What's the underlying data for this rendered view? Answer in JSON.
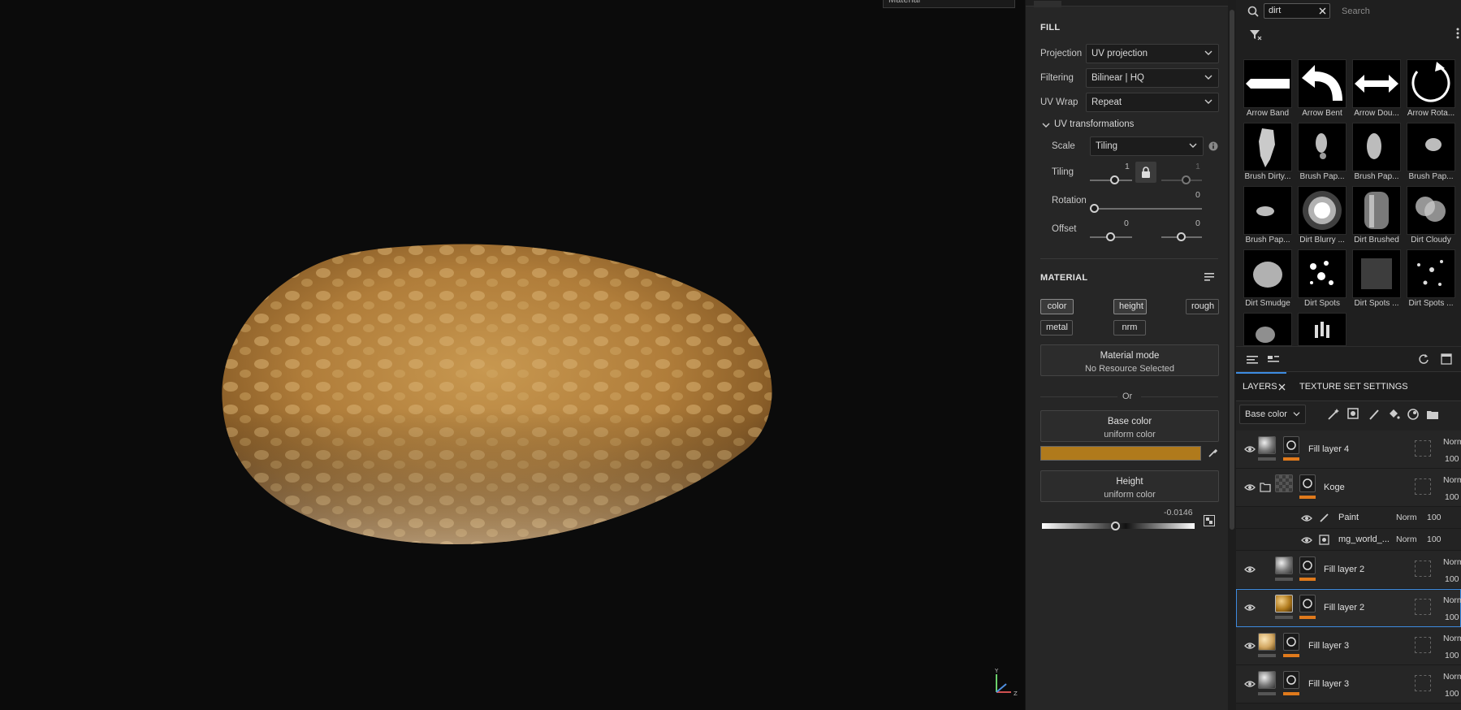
{
  "viewport": {
    "top_dropdown": "Material"
  },
  "properties": {
    "fill_title": "FILL",
    "projection": {
      "label": "Projection",
      "value": "UV projection"
    },
    "filtering": {
      "label": "Filtering",
      "value": "Bilinear | HQ"
    },
    "uv_wrap": {
      "label": "UV Wrap",
      "value": "Repeat"
    },
    "uv_transformations": "UV transformations",
    "scale": {
      "label": "Scale",
      "value": "Tiling"
    },
    "tiling": {
      "label": "Tiling",
      "value_u": "1",
      "value_v": "1"
    },
    "rotation": {
      "label": "Rotation",
      "value": "0"
    },
    "offset": {
      "label": "Offset",
      "value_u": "0",
      "value_v": "0"
    },
    "material_title": "MATERIAL",
    "channels": [
      "color",
      "height",
      "rough",
      "metal",
      "nrm"
    ],
    "material_mode": {
      "title": "Material mode",
      "value": "No Resource Selected"
    },
    "or_label": "Or",
    "base_color": {
      "title": "Base color",
      "value": "uniform color",
      "swatch": "#b07a1c"
    },
    "height": {
      "title": "Height",
      "value": "uniform color",
      "amount": "-0.0146"
    }
  },
  "shelf": {
    "search_value": "dirt",
    "search_placeholder": "Search",
    "items": [
      "Arrow Band",
      "Arrow Bent",
      "Arrow Dou...",
      "Arrow Rota...",
      "Brush Dirty...",
      "Brush Pap...",
      "Brush Pap...",
      "Brush Pap...",
      "Brush Pap...",
      "Dirt Blurry ...",
      "Dirt Brushed",
      "Dirt Cloudy",
      "Dirt Smudge",
      "Dirt Spots",
      "Dirt Spots ...",
      "Dirt Spots ..."
    ]
  },
  "layers": {
    "tab_layers": "LAYERS",
    "tab_texture": "TEXTURE SET SETTINGS",
    "channel": "Base color",
    "rows": [
      {
        "name": "Fill layer 4",
        "blend": "Norm",
        "opacity": "100"
      },
      {
        "name": "Koge",
        "blend": "Norm",
        "opacity": "100"
      },
      {
        "name": "Paint",
        "blend": "Norm",
        "opacity": "100"
      },
      {
        "name": "mg_world_...",
        "blend": "Norm",
        "opacity": "100"
      },
      {
        "name": "Fill layer 2",
        "blend": "Norm",
        "opacity": "100"
      },
      {
        "name": "Fill layer 2",
        "blend": "Norm",
        "opacity": "100"
      },
      {
        "name": "Fill layer 3",
        "blend": "Norm",
        "opacity": "100"
      },
      {
        "name": "Fill layer 3",
        "blend": "Norm",
        "opacity": "100"
      }
    ]
  },
  "colors": {
    "accent": "#3d8be0",
    "orange": "#e07a1c"
  }
}
